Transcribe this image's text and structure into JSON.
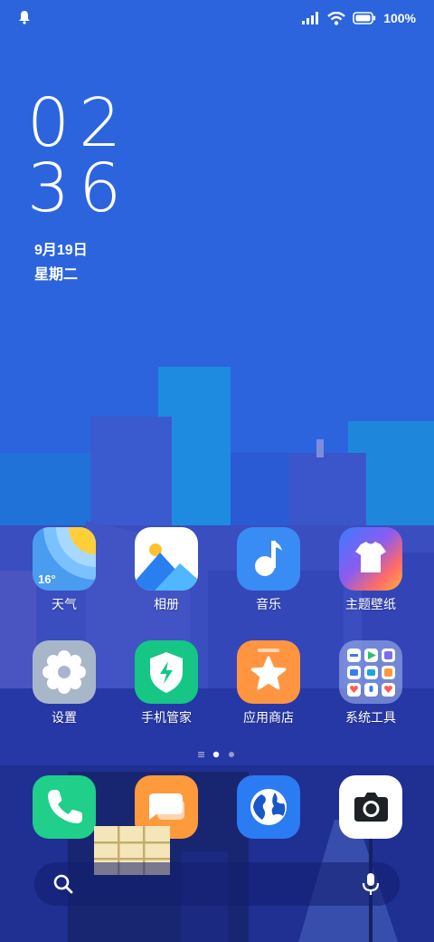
{
  "status_bar": {
    "battery_percent": "100%",
    "icons": [
      "bell-icon",
      "signal-icon",
      "wifi-icon",
      "battery-icon"
    ]
  },
  "clock": {
    "hour": "02",
    "minute": "36"
  },
  "date": {
    "day": "9月19日",
    "weekday": "星期二"
  },
  "apps": [
    {
      "label": "天气",
      "icon": "weather-icon",
      "temp": "16°"
    },
    {
      "label": "相册",
      "icon": "gallery-icon"
    },
    {
      "label": "音乐",
      "icon": "music-icon"
    },
    {
      "label": "主题壁纸",
      "icon": "themes-icon"
    },
    {
      "label": "设置",
      "icon": "settings-icon"
    },
    {
      "label": "手机管家",
      "icon": "security-icon"
    },
    {
      "label": "应用商店",
      "icon": "app-store-icon"
    },
    {
      "label": "系统工具",
      "icon": "tools-folder-icon"
    }
  ],
  "page_indicator": {
    "pages": 2,
    "current": 1
  },
  "dock": [
    "phone-icon",
    "messages-icon",
    "browser-icon",
    "camera-icon"
  ],
  "search_bar": {
    "icons": [
      "search-icon",
      "microphone-icon"
    ]
  },
  "colors": {
    "wallpaper_top": "#2f63e0",
    "wallpaper_bottom": "#1b2d91",
    "phone_green": "#1fcf8a",
    "message_orange": "#ff9a3c",
    "browser_blue": "#2b7bf3"
  }
}
